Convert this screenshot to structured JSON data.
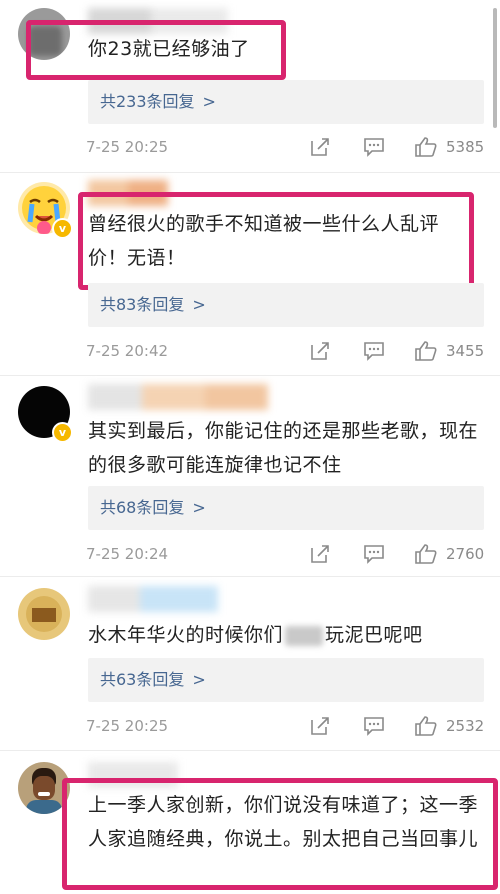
{
  "comments": [
    {
      "text": "你23就已经够油了",
      "replies": "共233条回复",
      "time": "7-25 20:25",
      "likes": "5385"
    },
    {
      "text": "曾经很火的歌手不知道被一些什么人乱评价！无语！",
      "replies": "共83条回复",
      "time": "7-25 20:42",
      "likes": "3455"
    },
    {
      "text": "其实到最后，你能记住的还是那些老歌，现在的很多歌可能连旋律也记不住",
      "replies": "共68条回复",
      "time": "7-25 20:24",
      "likes": "2760"
    },
    {
      "text_before": "水木年华火的时候你们",
      "text_after": "玩泥巴呢吧",
      "replies": "共63条回复",
      "time": "7-25 20:25",
      "likes": "2532"
    },
    {
      "text": "上一季人家创新，你们说没有味道了；这一季人家追随经典，你说土。别太把自己当回事儿"
    }
  ],
  "icons": {
    "share": "share-icon",
    "comment": "comment-icon",
    "like": "thumbs-up-icon",
    "verified": "verified-badge-icon",
    "chevron": "chevron-right-icon"
  },
  "colors": {
    "highlight": "#d8256e",
    "reply_link": "#476791",
    "meta_gray": "#9a9a9a",
    "verified": "#f6b800"
  },
  "glyphs": {
    "chevron": ">",
    "verified": "v"
  }
}
